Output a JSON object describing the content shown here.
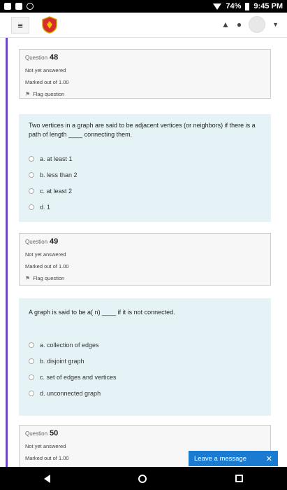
{
  "status": {
    "battery": "74%",
    "time": "9:45 PM"
  },
  "app": {
    "menu_icon": "≡"
  },
  "questions": [
    {
      "label": "Question",
      "number": "48",
      "state": "Not yet answered",
      "marked": "Marked out of 1.00",
      "flag": "Flag question",
      "text": "Two vertices in a graph are said to be adjacent vertices (or neighbors) if there is a path of length ____ connecting them.",
      "options": [
        "a. at least 1",
        "b. less than 2",
        "c. at least 2",
        "d. 1"
      ]
    },
    {
      "label": "Question",
      "number": "49",
      "state": "Not yet answered",
      "marked": "Marked out of 1.00",
      "flag": "Flag question",
      "text": "A graph is said to be a( n) ____ if it is not connected.",
      "options": [
        "a. collection of edges",
        "b. disjoint graph",
        "c. set of edges and vertices",
        "d. unconnected graph"
      ]
    },
    {
      "label": "Question",
      "number": "50",
      "state": "Not yet answered",
      "marked": "Marked out of 1.00"
    }
  ],
  "chat": {
    "label": "Leave a message",
    "close": "✕"
  },
  "colors": {
    "accent": "#6b46c1",
    "question_bg": "#e6f3f6",
    "chat_bg": "#1a7bd1"
  }
}
